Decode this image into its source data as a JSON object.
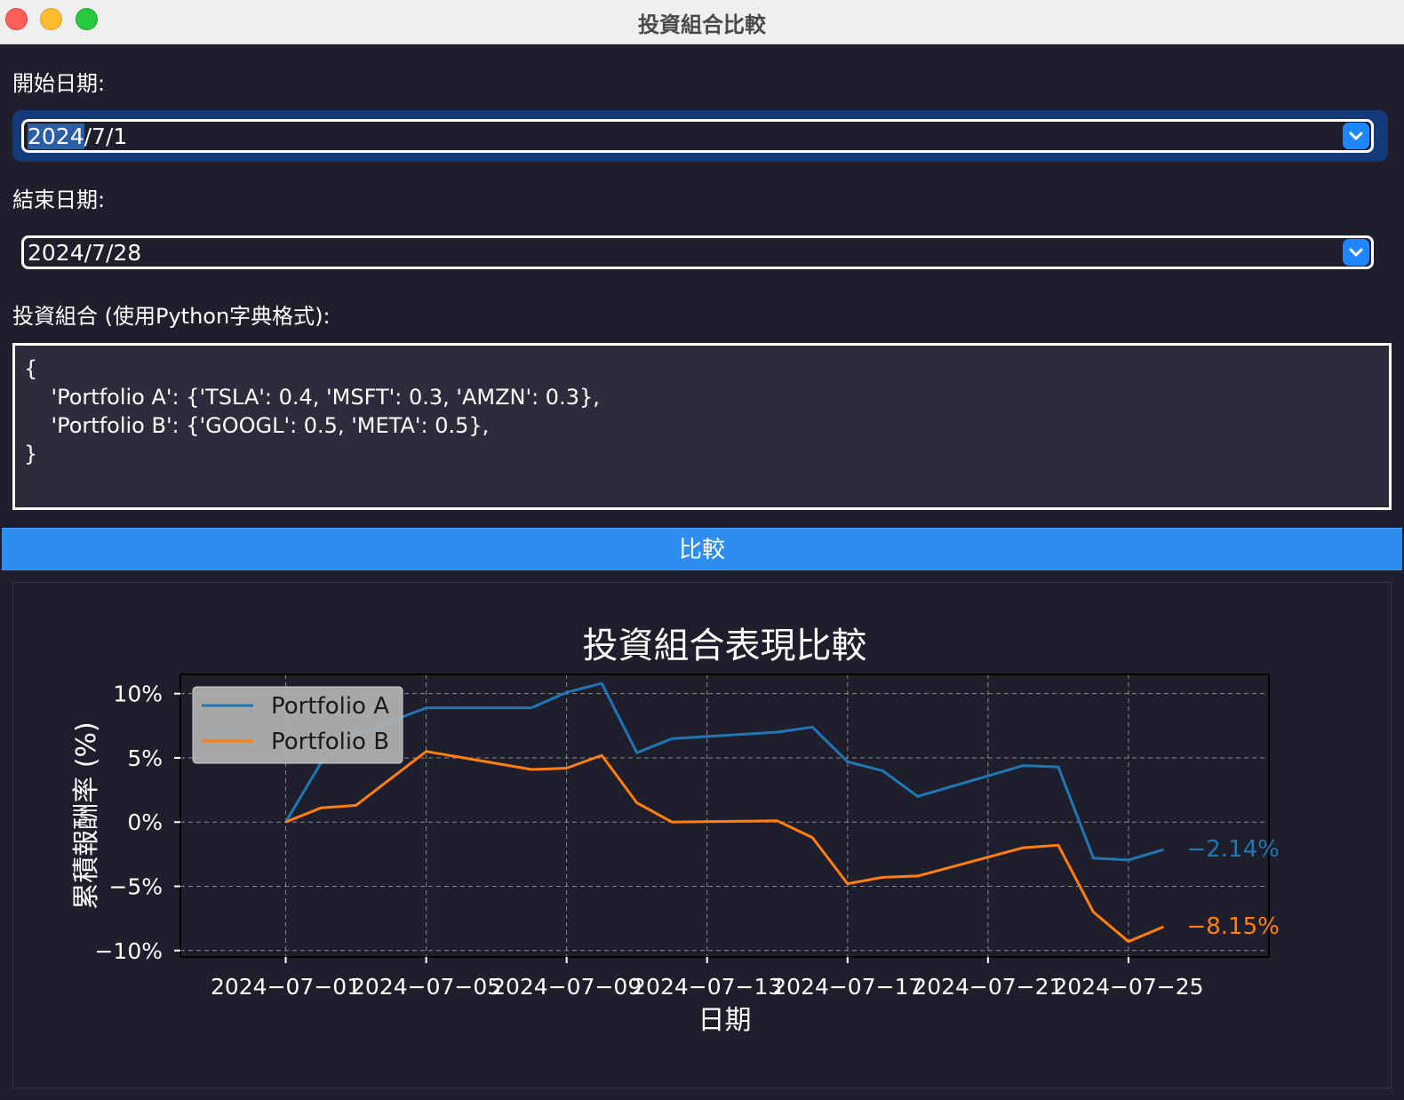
{
  "window": {
    "title": "投資組合比較"
  },
  "form": {
    "start_label": "開始日期:",
    "start_value_selected": "2024",
    "start_value_rest": "/7/1",
    "end_label": "結束日期:",
    "end_value": "2024/7/28",
    "portfolio_label": "投資組合 (使用Python字典格式):",
    "portfolio_lines": [
      "{",
      "    'Portfolio A': {'TSLA': 0.4, 'MSFT': 0.3, 'AMZN': 0.3},",
      "    'Portfolio B': {'GOOGL': 0.5, 'META': 0.5},",
      "}"
    ],
    "compare_button": "比較"
  },
  "chart_data": {
    "type": "line",
    "title": "投資組合表現比較",
    "xlabel": "日期",
    "ylabel": "累積報酬率 (%)",
    "ylim": [
      -10.5,
      11.5
    ],
    "y_ticks": [
      10,
      5,
      0,
      -5,
      -10
    ],
    "y_tick_labels": [
      "10%",
      "5%",
      "0%",
      "−5%",
      "−10%"
    ],
    "x_ticks": [
      "2024-07-01",
      "2024-07-05",
      "2024-07-09",
      "2024-07-13",
      "2024-07-17",
      "2024-07-21",
      "2024-07-25"
    ],
    "x_tick_labels": [
      "2024−07−01",
      "2024−07−05",
      "2024−07−09",
      "2024−07−13",
      "2024−07−17",
      "2024−07−21",
      "2024−07−25"
    ],
    "grid": true,
    "legend_position": "top-left",
    "series": [
      {
        "name": "Portfolio A",
        "color": "#1f77b4",
        "end_label": "−2.14%",
        "points": [
          [
            "2024-07-01",
            0.0
          ],
          [
            "2024-07-02",
            4.6
          ],
          [
            "2024-07-03",
            6.8
          ],
          [
            "2024-07-05",
            8.9
          ],
          [
            "2024-07-08",
            8.9
          ],
          [
            "2024-07-09",
            10.1
          ],
          [
            "2024-07-10",
            10.8
          ],
          [
            "2024-07-11",
            5.4
          ],
          [
            "2024-07-12",
            6.5
          ],
          [
            "2024-07-15",
            7.0
          ],
          [
            "2024-07-16",
            7.4
          ],
          [
            "2024-07-17",
            4.7
          ],
          [
            "2024-07-18",
            4.0
          ],
          [
            "2024-07-19",
            2.0
          ],
          [
            "2024-07-22",
            4.4
          ],
          [
            "2024-07-23",
            4.3
          ],
          [
            "2024-07-24",
            -2.8
          ],
          [
            "2024-07-25",
            -2.95
          ],
          [
            "2024-07-26",
            -2.14
          ]
        ]
      },
      {
        "name": "Portfolio B",
        "color": "#ff7f0e",
        "end_label": "−8.15%",
        "points": [
          [
            "2024-07-01",
            0.0
          ],
          [
            "2024-07-02",
            1.1
          ],
          [
            "2024-07-03",
            1.3
          ],
          [
            "2024-07-05",
            5.5
          ],
          [
            "2024-07-08",
            4.1
          ],
          [
            "2024-07-09",
            4.2
          ],
          [
            "2024-07-10",
            5.2
          ],
          [
            "2024-07-11",
            1.5
          ],
          [
            "2024-07-12",
            0.0
          ],
          [
            "2024-07-15",
            0.1
          ],
          [
            "2024-07-16",
            -1.2
          ],
          [
            "2024-07-17",
            -4.8
          ],
          [
            "2024-07-18",
            -4.3
          ],
          [
            "2024-07-19",
            -4.2
          ],
          [
            "2024-07-22",
            -2.0
          ],
          [
            "2024-07-23",
            -1.8
          ],
          [
            "2024-07-24",
            -7.0
          ],
          [
            "2024-07-25",
            -9.3
          ],
          [
            "2024-07-26",
            -8.15
          ]
        ]
      }
    ]
  },
  "colors": {
    "background": "#1f1e2c",
    "button": "#2d8ef0",
    "focus_ring": "#153a7a",
    "dropdown_button": "#1e86ff"
  }
}
